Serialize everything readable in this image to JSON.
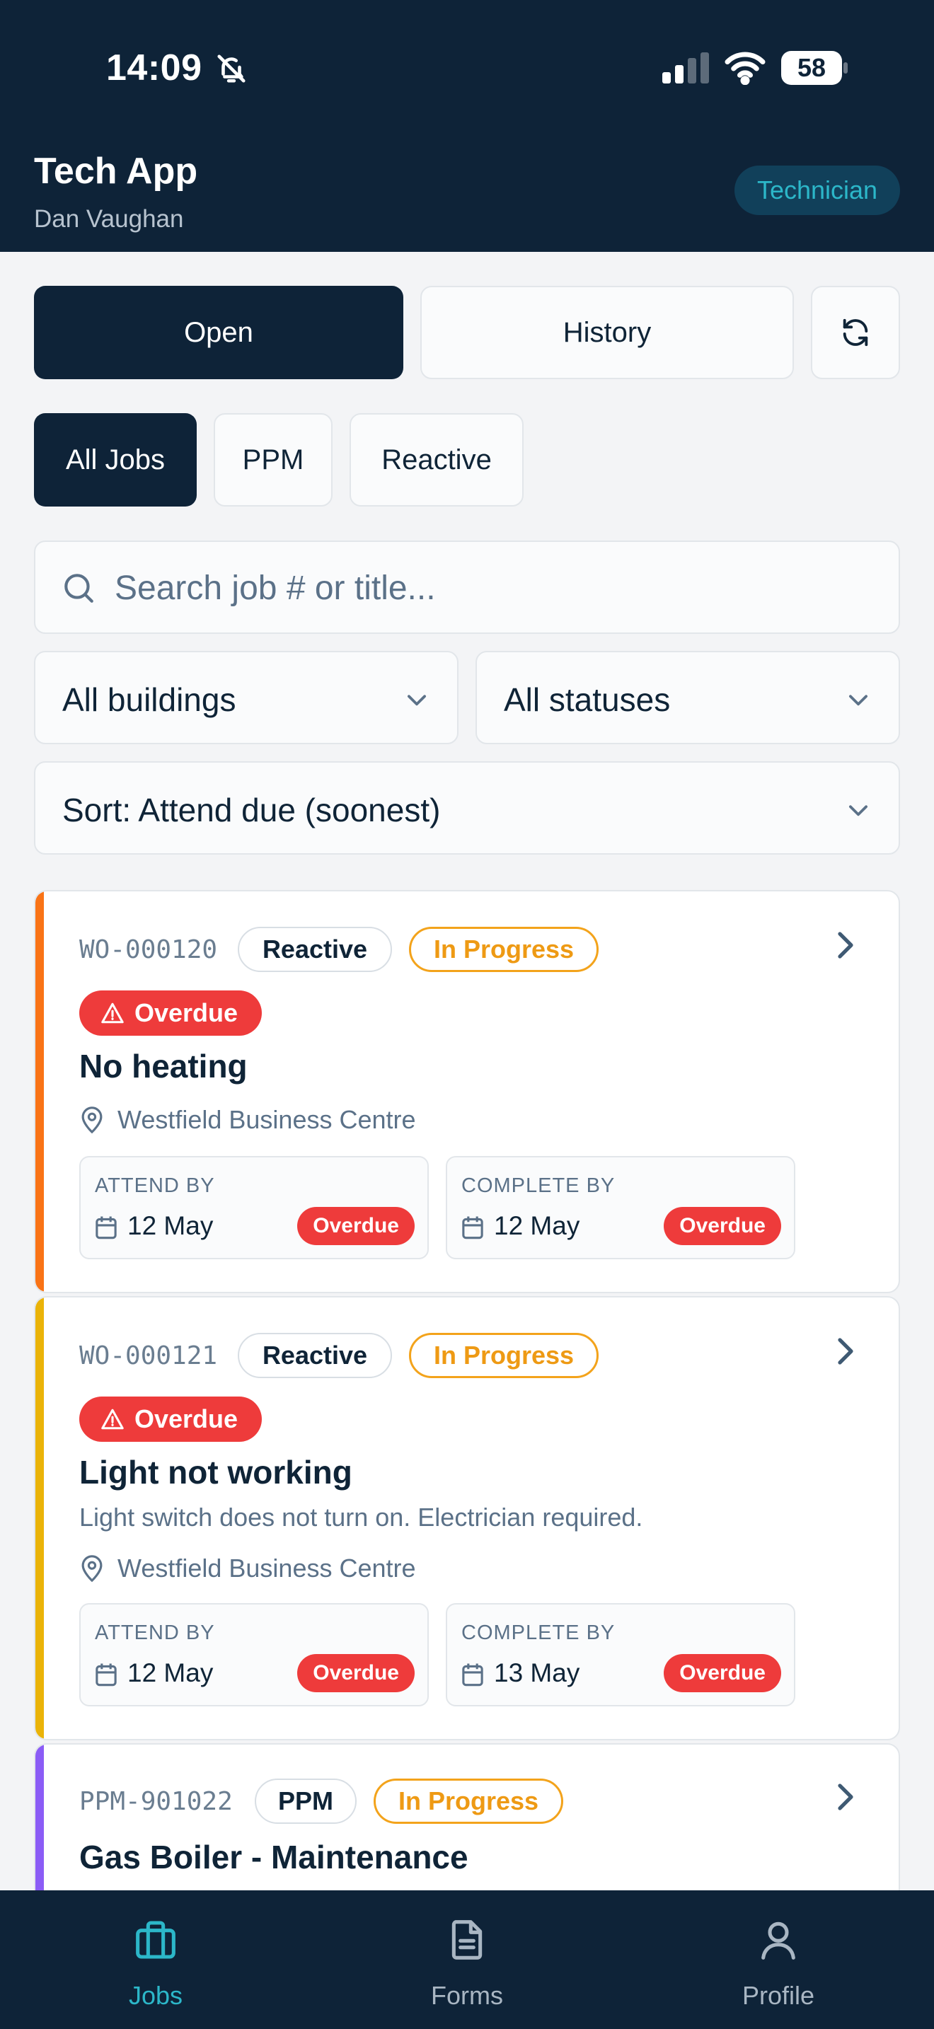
{
  "status_bar": {
    "time": "14:09",
    "battery": "58"
  },
  "header": {
    "title": "Tech App",
    "user": "Dan Vaughan",
    "role": "Technician"
  },
  "tabs": {
    "open": "Open",
    "history": "History"
  },
  "filters": {
    "all": "All Jobs",
    "ppm": "PPM",
    "reactive": "Reactive"
  },
  "search": {
    "placeholder": "Search job # or title..."
  },
  "selects": {
    "buildings": "All buildings",
    "statuses": "All statuses",
    "sort": "Sort: Attend due (soonest)"
  },
  "colors": {
    "navy": "#0E2338",
    "orange": "#F97316",
    "yellow": "#EAB308",
    "purple": "#8B5CF6",
    "red": "#EE3B3B",
    "teal": "#2CB7C9"
  },
  "jobs": [
    {
      "id": "WO-000120",
      "type": "Reactive",
      "status": "In Progress",
      "flag": "Overdue",
      "title": "No heating",
      "location": "Westfield Business Centre",
      "attend_label": "ATTEND BY",
      "attend_date": "12 May",
      "attend_flag": "Overdue",
      "complete_label": "COMPLETE BY",
      "complete_date": "12 May",
      "complete_flag": "Overdue"
    },
    {
      "id": "WO-000121",
      "type": "Reactive",
      "status": "In Progress",
      "flag": "Overdue",
      "title": "Light not working",
      "description": "Light switch does not turn on. Electrician required.",
      "location": "Westfield Business Centre",
      "attend_label": "ATTEND BY",
      "attend_date": "12 May",
      "attend_flag": "Overdue",
      "complete_label": "COMPLETE BY",
      "complete_date": "13 May",
      "complete_flag": "Overdue"
    },
    {
      "id": "PPM-901022",
      "type": "PPM",
      "status": "In Progress",
      "title": "Gas Boiler - Maintenance"
    }
  ],
  "nav": {
    "jobs": "Jobs",
    "forms": "Forms",
    "profile": "Profile"
  }
}
